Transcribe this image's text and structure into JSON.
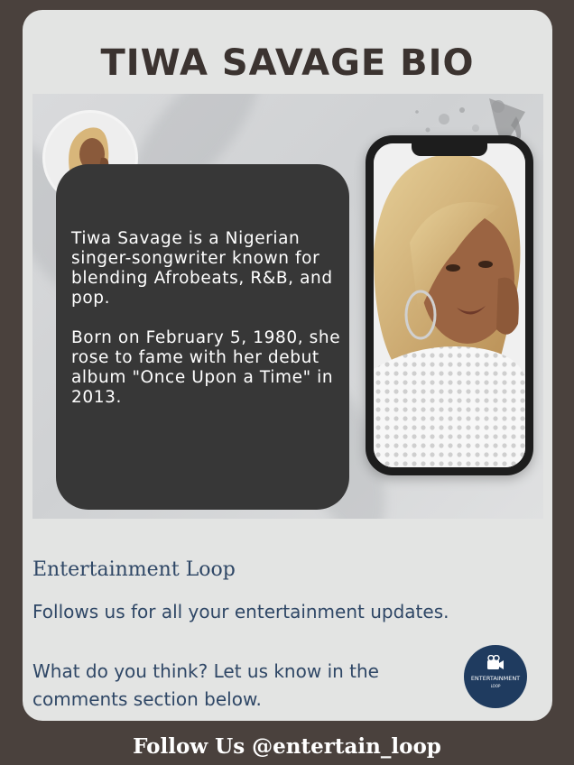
{
  "title": "TIWA SAVAGE BIO",
  "bio": {
    "paragraph_1": "Tiwa Savage is a Nigerian singer-songwriter known for blending Afrobeats, R&B, and pop.",
    "paragraph_2": "Born on February 5, 1980, she rose to fame with her debut album \"Once Upon a Time\" in 2013."
  },
  "brand": {
    "name": "Entertainment Loop",
    "follow_text": "Follows us for all your entertainment updates.",
    "comment_text": "What do you think? Let us know in the comments section below.",
    "logo_name": "ENTERTAINMENT",
    "logo_sub": "LOOP"
  },
  "footer": "Follow Us @entertain_loop",
  "colors": {
    "background": "#4a413d",
    "card": "#e3e4e3",
    "bio_box": "#373737",
    "brand_text": "#2f4766",
    "logo": "#1f3b5f"
  }
}
